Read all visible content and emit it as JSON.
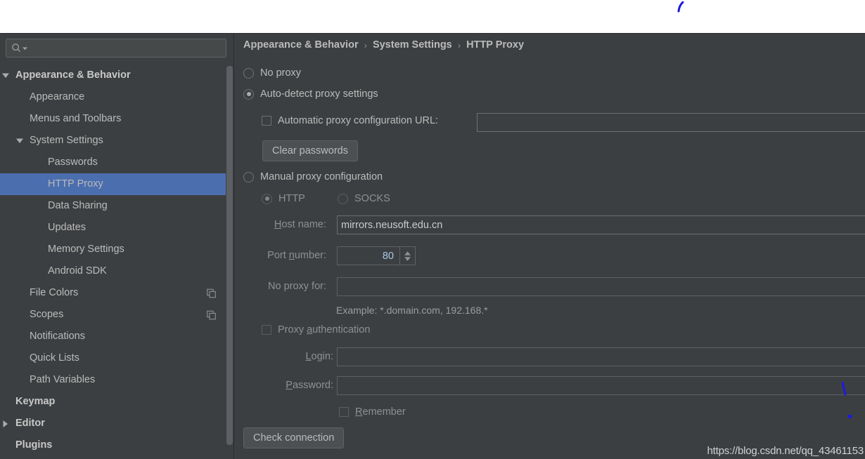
{
  "meta": {
    "accent_selection": "#4b6eaf",
    "background": "#3c3f41",
    "text": "#bbbbbb",
    "annotation_color": "#1a1ae6"
  },
  "search": {
    "value": "",
    "placeholder": "",
    "icon": "search-icon",
    "dropdown_icon": "chevron-down-icon"
  },
  "sidebar": {
    "items": [
      {
        "label": "Appearance & Behavior",
        "indent": 0,
        "twisty": "down",
        "bold": true,
        "selected": false,
        "trailing_icon": ""
      },
      {
        "label": "Appearance",
        "indent": 1,
        "twisty": "",
        "bold": false,
        "selected": false,
        "trailing_icon": ""
      },
      {
        "label": "Menus and Toolbars",
        "indent": 1,
        "twisty": "",
        "bold": false,
        "selected": false,
        "trailing_icon": ""
      },
      {
        "label": "System Settings",
        "indent": 1,
        "twisty": "down",
        "bold": false,
        "selected": false,
        "trailing_icon": ""
      },
      {
        "label": "Passwords",
        "indent": 2,
        "twisty": "",
        "bold": false,
        "selected": false,
        "trailing_icon": ""
      },
      {
        "label": "HTTP Proxy",
        "indent": 2,
        "twisty": "",
        "bold": false,
        "selected": true,
        "trailing_icon": ""
      },
      {
        "label": "Data Sharing",
        "indent": 2,
        "twisty": "",
        "bold": false,
        "selected": false,
        "trailing_icon": ""
      },
      {
        "label": "Updates",
        "indent": 2,
        "twisty": "",
        "bold": false,
        "selected": false,
        "trailing_icon": ""
      },
      {
        "label": "Memory Settings",
        "indent": 2,
        "twisty": "",
        "bold": false,
        "selected": false,
        "trailing_icon": ""
      },
      {
        "label": "Android SDK",
        "indent": 2,
        "twisty": "",
        "bold": false,
        "selected": false,
        "trailing_icon": ""
      },
      {
        "label": "File Colors",
        "indent": 1,
        "twisty": "",
        "bold": false,
        "selected": false,
        "trailing_icon": "copy-icon"
      },
      {
        "label": "Scopes",
        "indent": 1,
        "twisty": "",
        "bold": false,
        "selected": false,
        "trailing_icon": "copy-icon"
      },
      {
        "label": "Notifications",
        "indent": 1,
        "twisty": "",
        "bold": false,
        "selected": false,
        "trailing_icon": ""
      },
      {
        "label": "Quick Lists",
        "indent": 1,
        "twisty": "",
        "bold": false,
        "selected": false,
        "trailing_icon": ""
      },
      {
        "label": "Path Variables",
        "indent": 1,
        "twisty": "",
        "bold": false,
        "selected": false,
        "trailing_icon": ""
      },
      {
        "label": "Keymap",
        "indent": 0,
        "twisty": "",
        "bold": true,
        "selected": false,
        "trailing_icon": ""
      },
      {
        "label": "Editor",
        "indent": 0,
        "twisty": "right",
        "bold": true,
        "selected": false,
        "trailing_icon": ""
      },
      {
        "label": "Plugins",
        "indent": 0,
        "twisty": "",
        "bold": true,
        "selected": false,
        "trailing_icon": ""
      }
    ]
  },
  "breadcrumb": {
    "level1": "Appearance & Behavior",
    "sep1": "›",
    "level2": "System Settings",
    "sep2": "›",
    "level3": "HTTP Proxy"
  },
  "proxy": {
    "no_proxy_label": "No proxy",
    "no_proxy_selected": false,
    "auto_detect_label": "Auto-detect proxy settings",
    "auto_detect_selected": true,
    "auto_config_checkbox_label": "Automatic proxy configuration URL:",
    "auto_config_checked": false,
    "auto_config_url_value": "",
    "clear_passwords_label": "Clear passwords",
    "manual_label": "Manual proxy configuration",
    "manual_selected": false,
    "http_label": "HTTP",
    "http_selected": true,
    "socks_label": "SOCKS",
    "socks_selected": false,
    "host_label": "Host name:",
    "host_label_mnemonic": "H",
    "host_value": "mirrors.neusoft.edu.cn",
    "port_label": "Port number:",
    "port_label_mnemonic": "n",
    "port_value": "80",
    "no_proxy_for_label": "No proxy for:",
    "no_proxy_for_value": "",
    "example_hint": "Example: *.domain.com, 192.168.*",
    "proxy_auth_label": "Proxy authentication",
    "proxy_auth_mnemonic": "a",
    "proxy_auth_checked": false,
    "login_label": "Login:",
    "login_label_mnemonic": "L",
    "login_value": "",
    "password_label": "Password:",
    "password_label_mnemonic": "P",
    "password_value": "",
    "remember_label": "Remember",
    "remember_mnemonic": "R",
    "remember_checked": false,
    "check_connection_label": "Check connection"
  },
  "watermark": {
    "text": "https://blog.csdn.net/qq_43461153"
  }
}
